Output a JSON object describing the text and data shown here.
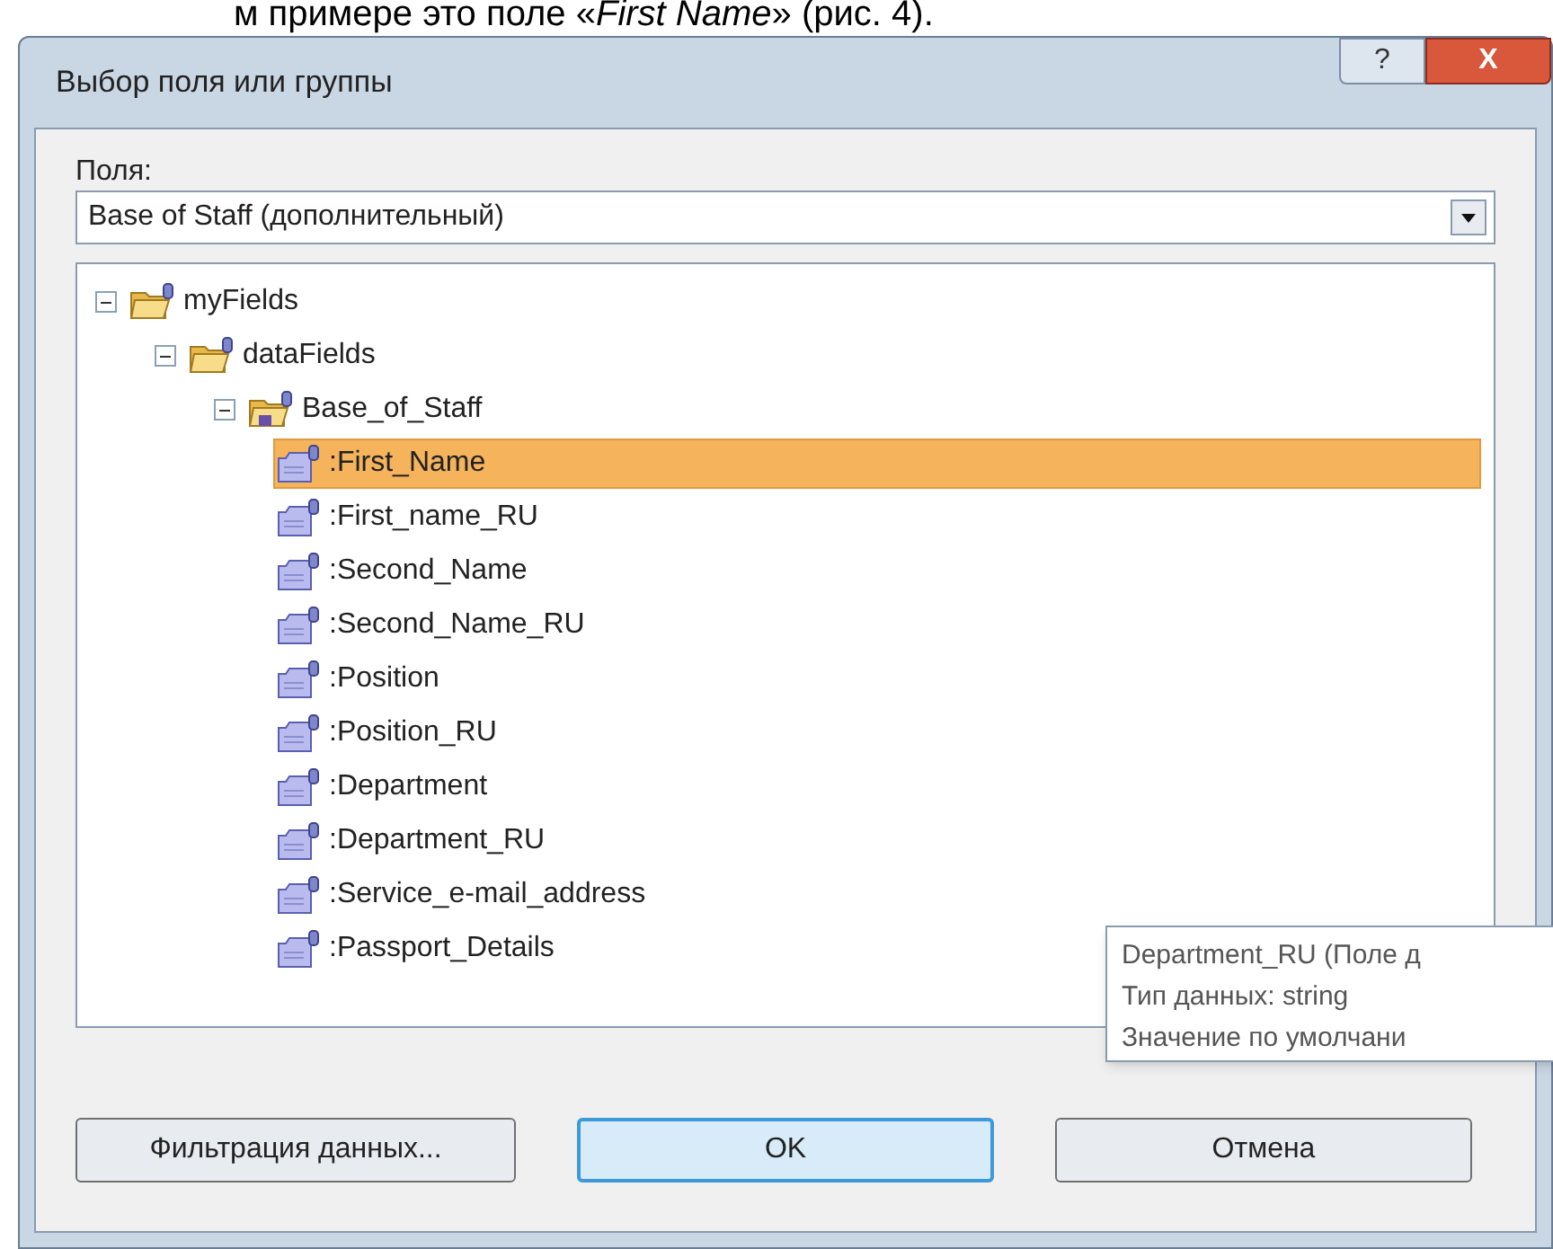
{
  "page_text": "м примере это поле «*First Name*» (рис. 4).",
  "window": {
    "title": "Выбор поля или группы"
  },
  "title_buttons": [
    {
      "kind": "help",
      "label": "?"
    },
    {
      "kind": "close",
      "label": "X"
    }
  ],
  "fields_label": "Поля:",
  "fields_combo": {
    "value": "Base of Staff (дополнительный)"
  },
  "tree": [
    {
      "label": "myFields",
      "kind": "folder",
      "expanded": true,
      "selected": false,
      "children": [
        {
          "label": "dataFields",
          "kind": "folder",
          "expanded": true,
          "selected": false,
          "children": [
            {
              "label": "Base_of_Staff",
              "kind": "group",
              "expanded": true,
              "selected": false,
              "children": [
                {
                  "label": ":First_Name",
                  "kind": "field",
                  "selected": true
                },
                {
                  "label": ":First_name_RU",
                  "kind": "field",
                  "selected": false
                },
                {
                  "label": ":Second_Name",
                  "kind": "field",
                  "selected": false
                },
                {
                  "label": ":Second_Name_RU",
                  "kind": "field",
                  "selected": false
                },
                {
                  "label": ":Position",
                  "kind": "field",
                  "selected": false
                },
                {
                  "label": ":Position_RU",
                  "kind": "field",
                  "selected": false
                },
                {
                  "label": ":Department",
                  "kind": "field",
                  "selected": false
                },
                {
                  "label": ":Department_RU",
                  "kind": "field",
                  "selected": false
                },
                {
                  "label": ":Service_e-mail_address",
                  "kind": "field",
                  "selected": false
                },
                {
                  "label": ":Passport_Details",
                  "kind": "field",
                  "selected": false
                }
              ]
            }
          ]
        }
      ]
    }
  ],
  "tooltip": [
    "Department_RU (Поле д",
    "Тип данных: string",
    "Значение по умолчани"
  ],
  "buttons": [
    {
      "label": "Фильтрация данных...",
      "kind": "normal"
    },
    {
      "label": "OK",
      "kind": "default"
    },
    {
      "label": "Отмена",
      "kind": "normal"
    }
  ]
}
